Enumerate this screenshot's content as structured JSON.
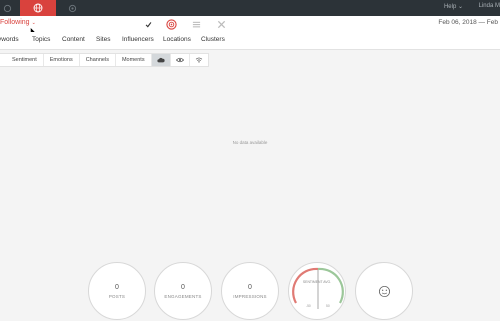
{
  "topbar": {
    "help_label": "Help",
    "help_caret": "⌄",
    "user_label": "Linda M"
  },
  "header": {
    "title": "Following",
    "title_caret": "⌄",
    "date_range": "Feb 06, 2018 — Feb"
  },
  "nav_tabs": [
    {
      "label": "ywords"
    },
    {
      "label": "Topics"
    },
    {
      "label": "Content"
    },
    {
      "label": "Sites"
    },
    {
      "label": "Influencers"
    },
    {
      "label": "Locations"
    },
    {
      "label": "Clusters"
    }
  ],
  "filters": {
    "buttons": [
      {
        "label": "Sentiment"
      },
      {
        "label": "Emotions"
      },
      {
        "label": "Channels"
      },
      {
        "label": "Moments"
      }
    ],
    "icons": [
      "cloud-icon",
      "eye-icon",
      "wifi-icon"
    ]
  },
  "main": {
    "empty_message": "No data available"
  },
  "metrics": [
    {
      "value": "0",
      "label": "POSTS"
    },
    {
      "value": "0",
      "label": "ENGAGEMENTS"
    },
    {
      "value": "0",
      "label": "IMPRESSIONS"
    }
  ],
  "sentiment_gauge": {
    "label": "SENTIMENT AVG.",
    "low": "-50",
    "high": "50"
  },
  "colors": {
    "accent": "#d9423d",
    "topbar": "#2c3338",
    "gauge_red": "#e07a74",
    "gauge_green": "#9cc79a"
  }
}
